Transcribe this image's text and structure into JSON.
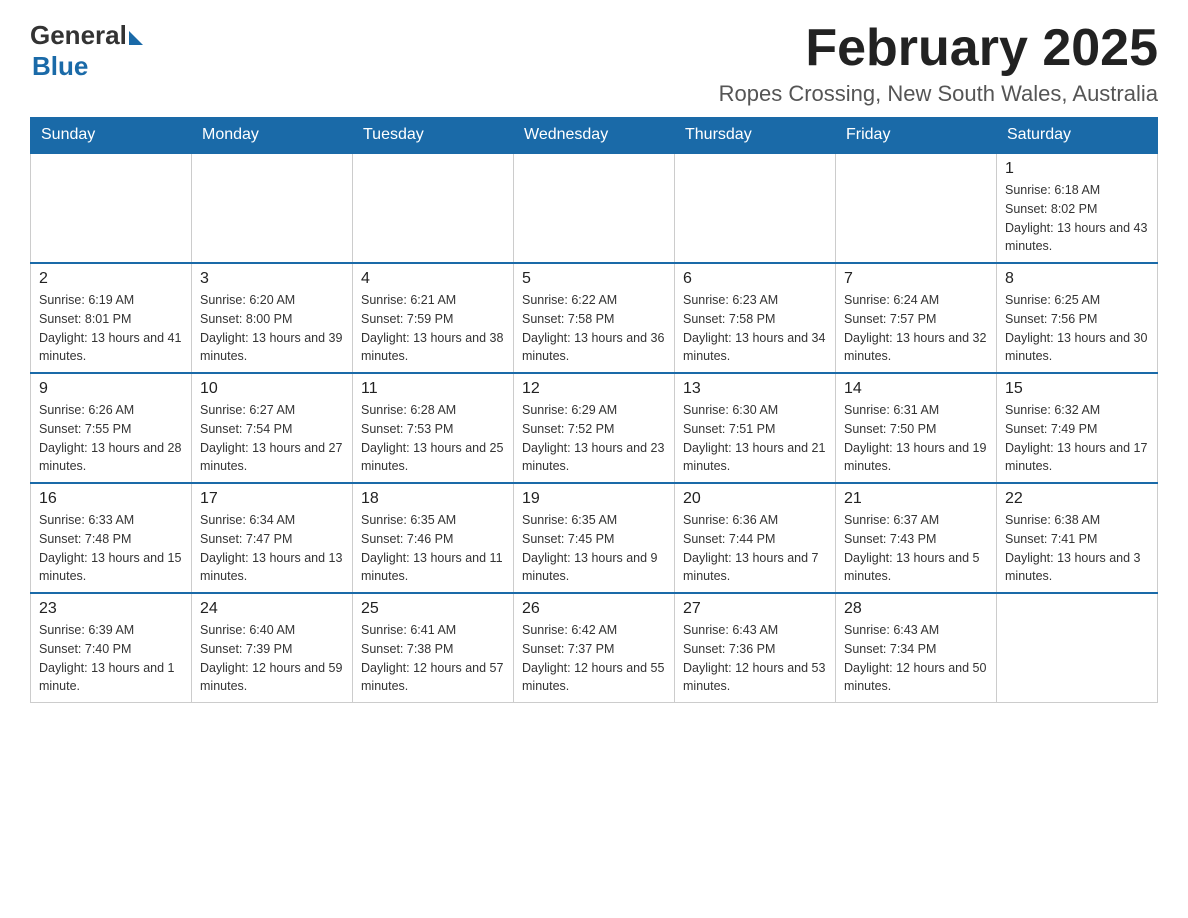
{
  "logo": {
    "general": "General",
    "blue": "Blue"
  },
  "header": {
    "month_year": "February 2025",
    "location": "Ropes Crossing, New South Wales, Australia"
  },
  "days_of_week": [
    "Sunday",
    "Monday",
    "Tuesday",
    "Wednesday",
    "Thursday",
    "Friday",
    "Saturday"
  ],
  "weeks": [
    [
      {
        "day": "",
        "info": ""
      },
      {
        "day": "",
        "info": ""
      },
      {
        "day": "",
        "info": ""
      },
      {
        "day": "",
        "info": ""
      },
      {
        "day": "",
        "info": ""
      },
      {
        "day": "",
        "info": ""
      },
      {
        "day": "1",
        "info": "Sunrise: 6:18 AM\nSunset: 8:02 PM\nDaylight: 13 hours and 43 minutes."
      }
    ],
    [
      {
        "day": "2",
        "info": "Sunrise: 6:19 AM\nSunset: 8:01 PM\nDaylight: 13 hours and 41 minutes."
      },
      {
        "day": "3",
        "info": "Sunrise: 6:20 AM\nSunset: 8:00 PM\nDaylight: 13 hours and 39 minutes."
      },
      {
        "day": "4",
        "info": "Sunrise: 6:21 AM\nSunset: 7:59 PM\nDaylight: 13 hours and 38 minutes."
      },
      {
        "day": "5",
        "info": "Sunrise: 6:22 AM\nSunset: 7:58 PM\nDaylight: 13 hours and 36 minutes."
      },
      {
        "day": "6",
        "info": "Sunrise: 6:23 AM\nSunset: 7:58 PM\nDaylight: 13 hours and 34 minutes."
      },
      {
        "day": "7",
        "info": "Sunrise: 6:24 AM\nSunset: 7:57 PM\nDaylight: 13 hours and 32 minutes."
      },
      {
        "day": "8",
        "info": "Sunrise: 6:25 AM\nSunset: 7:56 PM\nDaylight: 13 hours and 30 minutes."
      }
    ],
    [
      {
        "day": "9",
        "info": "Sunrise: 6:26 AM\nSunset: 7:55 PM\nDaylight: 13 hours and 28 minutes."
      },
      {
        "day": "10",
        "info": "Sunrise: 6:27 AM\nSunset: 7:54 PM\nDaylight: 13 hours and 27 minutes."
      },
      {
        "day": "11",
        "info": "Sunrise: 6:28 AM\nSunset: 7:53 PM\nDaylight: 13 hours and 25 minutes."
      },
      {
        "day": "12",
        "info": "Sunrise: 6:29 AM\nSunset: 7:52 PM\nDaylight: 13 hours and 23 minutes."
      },
      {
        "day": "13",
        "info": "Sunrise: 6:30 AM\nSunset: 7:51 PM\nDaylight: 13 hours and 21 minutes."
      },
      {
        "day": "14",
        "info": "Sunrise: 6:31 AM\nSunset: 7:50 PM\nDaylight: 13 hours and 19 minutes."
      },
      {
        "day": "15",
        "info": "Sunrise: 6:32 AM\nSunset: 7:49 PM\nDaylight: 13 hours and 17 minutes."
      }
    ],
    [
      {
        "day": "16",
        "info": "Sunrise: 6:33 AM\nSunset: 7:48 PM\nDaylight: 13 hours and 15 minutes."
      },
      {
        "day": "17",
        "info": "Sunrise: 6:34 AM\nSunset: 7:47 PM\nDaylight: 13 hours and 13 minutes."
      },
      {
        "day": "18",
        "info": "Sunrise: 6:35 AM\nSunset: 7:46 PM\nDaylight: 13 hours and 11 minutes."
      },
      {
        "day": "19",
        "info": "Sunrise: 6:35 AM\nSunset: 7:45 PM\nDaylight: 13 hours and 9 minutes."
      },
      {
        "day": "20",
        "info": "Sunrise: 6:36 AM\nSunset: 7:44 PM\nDaylight: 13 hours and 7 minutes."
      },
      {
        "day": "21",
        "info": "Sunrise: 6:37 AM\nSunset: 7:43 PM\nDaylight: 13 hours and 5 minutes."
      },
      {
        "day": "22",
        "info": "Sunrise: 6:38 AM\nSunset: 7:41 PM\nDaylight: 13 hours and 3 minutes."
      }
    ],
    [
      {
        "day": "23",
        "info": "Sunrise: 6:39 AM\nSunset: 7:40 PM\nDaylight: 13 hours and 1 minute."
      },
      {
        "day": "24",
        "info": "Sunrise: 6:40 AM\nSunset: 7:39 PM\nDaylight: 12 hours and 59 minutes."
      },
      {
        "day": "25",
        "info": "Sunrise: 6:41 AM\nSunset: 7:38 PM\nDaylight: 12 hours and 57 minutes."
      },
      {
        "day": "26",
        "info": "Sunrise: 6:42 AM\nSunset: 7:37 PM\nDaylight: 12 hours and 55 minutes."
      },
      {
        "day": "27",
        "info": "Sunrise: 6:43 AM\nSunset: 7:36 PM\nDaylight: 12 hours and 53 minutes."
      },
      {
        "day": "28",
        "info": "Sunrise: 6:43 AM\nSunset: 7:34 PM\nDaylight: 12 hours and 50 minutes."
      },
      {
        "day": "",
        "info": ""
      }
    ]
  ]
}
